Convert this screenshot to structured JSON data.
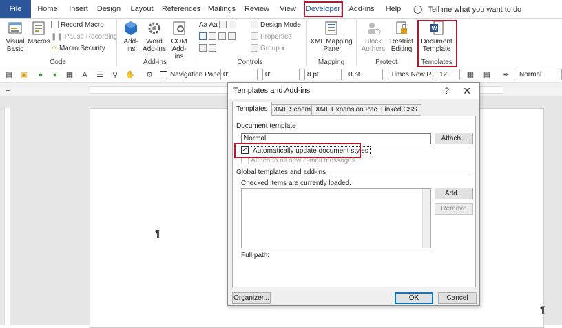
{
  "tabs": [
    {
      "label": "File"
    },
    {
      "label": "Home"
    },
    {
      "label": "Insert"
    },
    {
      "label": "Design"
    },
    {
      "label": "Layout"
    },
    {
      "label": "References"
    },
    {
      "label": "Mailings"
    },
    {
      "label": "Review"
    },
    {
      "label": "View"
    },
    {
      "label": "Developer"
    },
    {
      "label": "Add-ins"
    },
    {
      "label": "Help"
    }
  ],
  "tell_me": "Tell me what you want to do",
  "ribbon": {
    "code": {
      "label": "Code",
      "visual_basic": "Visual Basic",
      "macros": "Macros",
      "record_macro": "Record Macro",
      "pause_recording": "Pause Recording",
      "macro_security": "Macro Security"
    },
    "addins": {
      "label": "Add-ins",
      "add_ins": "Add-ins",
      "word_addins": "Word Add-ins",
      "com_addins": "COM Add-ins"
    },
    "controls": {
      "label": "Controls",
      "design_mode": "Design Mode",
      "properties": "Properties",
      "group": "Group"
    },
    "mapping": {
      "label": "Mapping",
      "xml_mapping_pane": "XML Mapping Pane"
    },
    "protect": {
      "label": "Protect",
      "block_authors": "Block Authors",
      "restrict_editing": "Restrict Editing"
    },
    "templates": {
      "label": "Templates",
      "document_template": "Document Template"
    }
  },
  "toolbar": {
    "navigation_pane": "Navigation Pane",
    "indent_left": "0\"",
    "indent_right": "0\"",
    "spacing_before": "8 pt",
    "spacing_after": "0 pt",
    "font_name": "Times New R",
    "font_size": "12",
    "style": "Normal"
  },
  "document": {
    "pilcrow": "¶"
  },
  "dialog": {
    "title": "Templates and Add-ins",
    "help": "?",
    "close": "✕",
    "tabs": [
      {
        "label": "Templates"
      },
      {
        "label": "XML Schema"
      },
      {
        "label": "XML Expansion Packs"
      },
      {
        "label": "Linked CSS"
      }
    ],
    "document_template_label": "Document template",
    "document_template_value": "Normal",
    "attach_button": "Attach...",
    "auto_update_label": "Automatically update document styles",
    "auto_update_checked": true,
    "attach_all_label": "Attach to all new e-mail messages",
    "global_label": "Global templates and add-ins",
    "checked_loaded": "Checked items are currently loaded.",
    "add_button": "Add...",
    "remove_button": "Remove",
    "full_path_label": "Full path:",
    "organizer_button": "Organizer...",
    "ok_button": "OK",
    "cancel_button": "Cancel"
  },
  "colors": {
    "file_tab": "#2b579a",
    "highlight": "#b3172f",
    "word_icon": "#2b579a"
  }
}
